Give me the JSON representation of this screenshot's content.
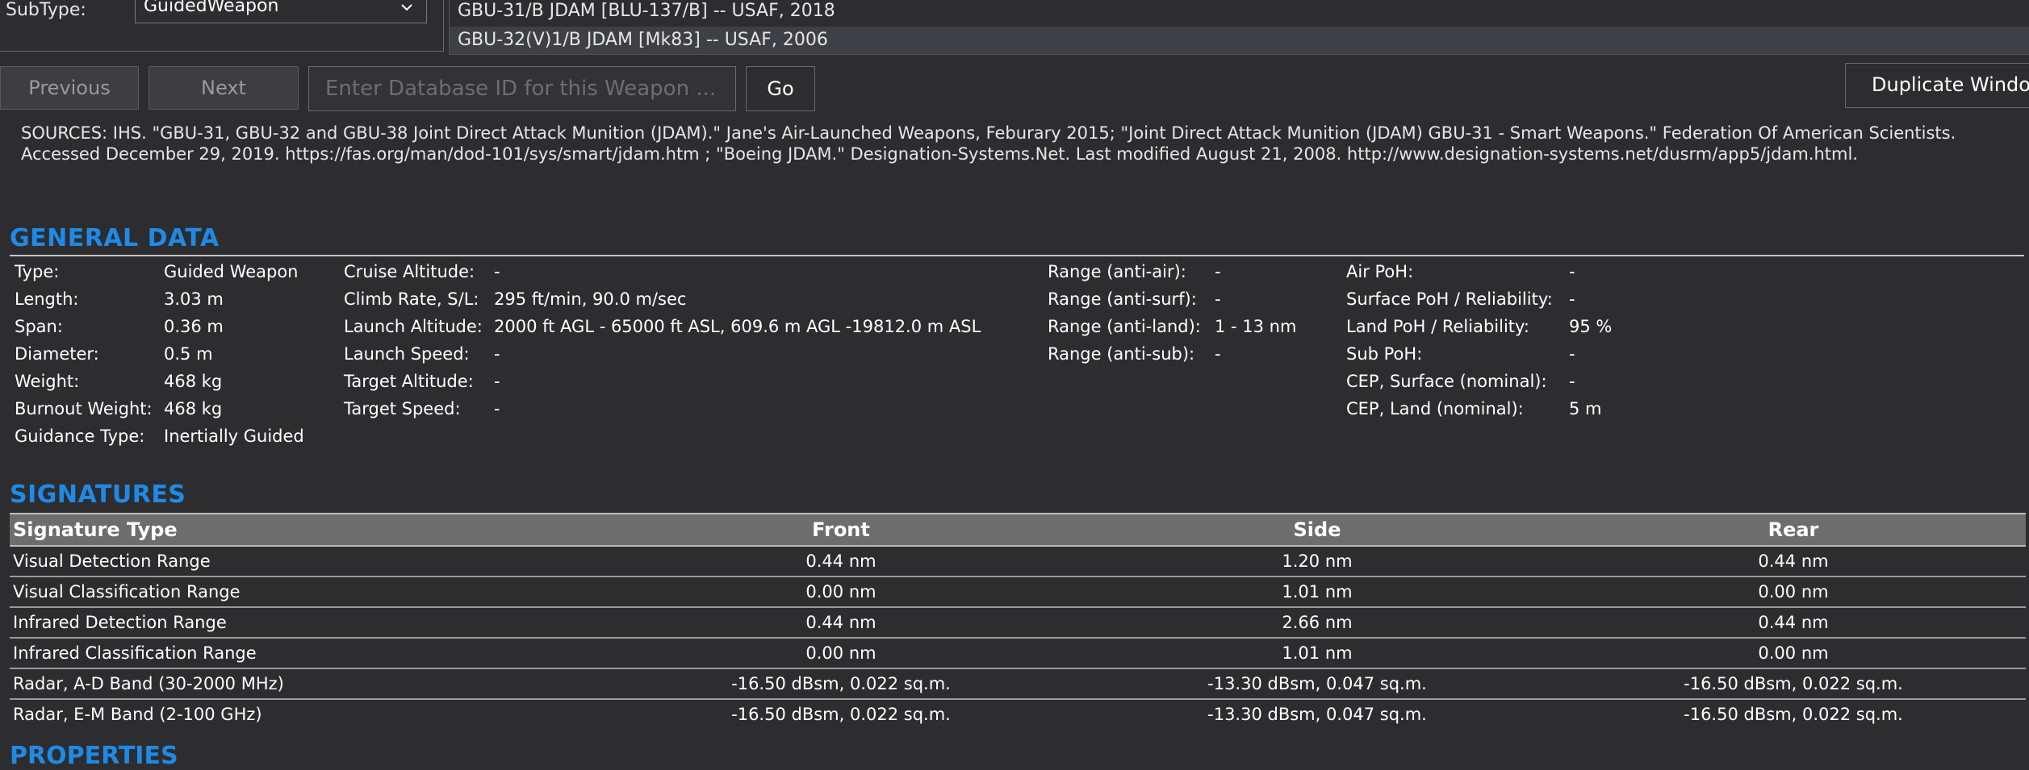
{
  "filter": {
    "subtype_label": "SubType:",
    "subtype_value": "GuidedWeapon"
  },
  "weapon_list": {
    "items": [
      "GBU-31/B JDAM [BLU-137/B] -- USAF, 2018",
      "GBU-32(V)1/B JDAM [Mk83] -- USAF, 2006"
    ]
  },
  "nav": {
    "previous": "Previous",
    "next": "Next",
    "id_placeholder": "Enter Database ID for this Weapon ...",
    "go": "Go",
    "duplicate": "Duplicate Window"
  },
  "sources": "SOURCES: IHS. \"GBU-31, GBU-32 and GBU-38 Joint Direct Attack Munition (JDAM).\" Jane's Air-Launched Weapons, Feburary 2015; \"Joint Direct Attack Munition (JDAM) GBU-31 - Smart Weapons.\" Federation Of American Scientists. Accessed December 29, 2019. https://fas.org/man/dod-101/sys/smart/jdam.htm ; \"Boeing JDAM.\" Designation-Systems.Net. Last modified August 21, 2008. http://www.designation-systems.net/dusrm/app5/jdam.html.",
  "general": {
    "title": "GENERAL DATA",
    "col1": [
      {
        "label": "Type:",
        "value": "Guided Weapon"
      },
      {
        "label": "Length:",
        "value": "3.03 m"
      },
      {
        "label": "Span:",
        "value": "0.36 m"
      },
      {
        "label": "Diameter:",
        "value": "0.5 m"
      },
      {
        "label": "Weight:",
        "value": "468 kg"
      },
      {
        "label": "Burnout Weight:",
        "value": "468 kg"
      },
      {
        "label": "Guidance Type:",
        "value": "Inertially Guided"
      }
    ],
    "col2": [
      {
        "label": "Cruise Altitude:",
        "value": "-"
      },
      {
        "label": "Climb Rate, S/L:",
        "value": "295 ft/min, 90.0 m/sec"
      },
      {
        "label": "Launch Altitude:",
        "value": "2000 ft AGL - 65000 ft ASL, 609.6 m AGL -19812.0 m ASL"
      },
      {
        "label": "Launch Speed:",
        "value": "-"
      },
      {
        "label": "Target Altitude:",
        "value": "-"
      },
      {
        "label": "Target Speed:",
        "value": "-"
      }
    ],
    "col3": [
      {
        "label": "Range (anti-air):",
        "value": "-"
      },
      {
        "label": "Range (anti-surf):",
        "value": "-"
      },
      {
        "label": "Range (anti-land):",
        "value": "1 - 13 nm"
      },
      {
        "label": "Range (anti-sub):",
        "value": "-"
      }
    ],
    "col4": [
      {
        "label": "Air PoH:",
        "value": "-"
      },
      {
        "label": "Surface PoH / Reliability:",
        "value": "-"
      },
      {
        "label": "Land PoH / Reliability:",
        "value": "95 %"
      },
      {
        "label": "Sub PoH:",
        "value": "-"
      },
      {
        "label": "CEP, Surface (nominal):",
        "value": "-"
      },
      {
        "label": "CEP, Land (nominal):",
        "value": "5 m"
      }
    ]
  },
  "signatures": {
    "title": "SIGNATURES",
    "headers": [
      "Signature Type",
      "Front",
      "Side",
      "Rear"
    ],
    "rows": [
      [
        "Visual Detection Range",
        "0.44 nm",
        "1.20 nm",
        "0.44 nm"
      ],
      [
        "Visual Classification Range",
        "0.00 nm",
        "1.01 nm",
        "0.00 nm"
      ],
      [
        "Infrared Detection Range",
        "0.44 nm",
        "2.66 nm",
        "0.44 nm"
      ],
      [
        "Infrared Classification Range",
        "0.00 nm",
        "1.01 nm",
        "0.00 nm"
      ],
      [
        "Radar, A-D Band (30-2000 MHz)",
        "-16.50 dBsm, 0.022 sq.m.",
        "-13.30 dBsm, 0.047 sq.m.",
        "-16.50 dBsm, 0.022 sq.m."
      ],
      [
        "Radar, E-M Band (2-100 GHz)",
        "-16.50 dBsm, 0.022 sq.m.",
        "-13.30 dBsm, 0.047 sq.m.",
        "-16.50 dBsm, 0.022 sq.m."
      ]
    ]
  },
  "properties": {
    "title": "PROPERTIES"
  }
}
